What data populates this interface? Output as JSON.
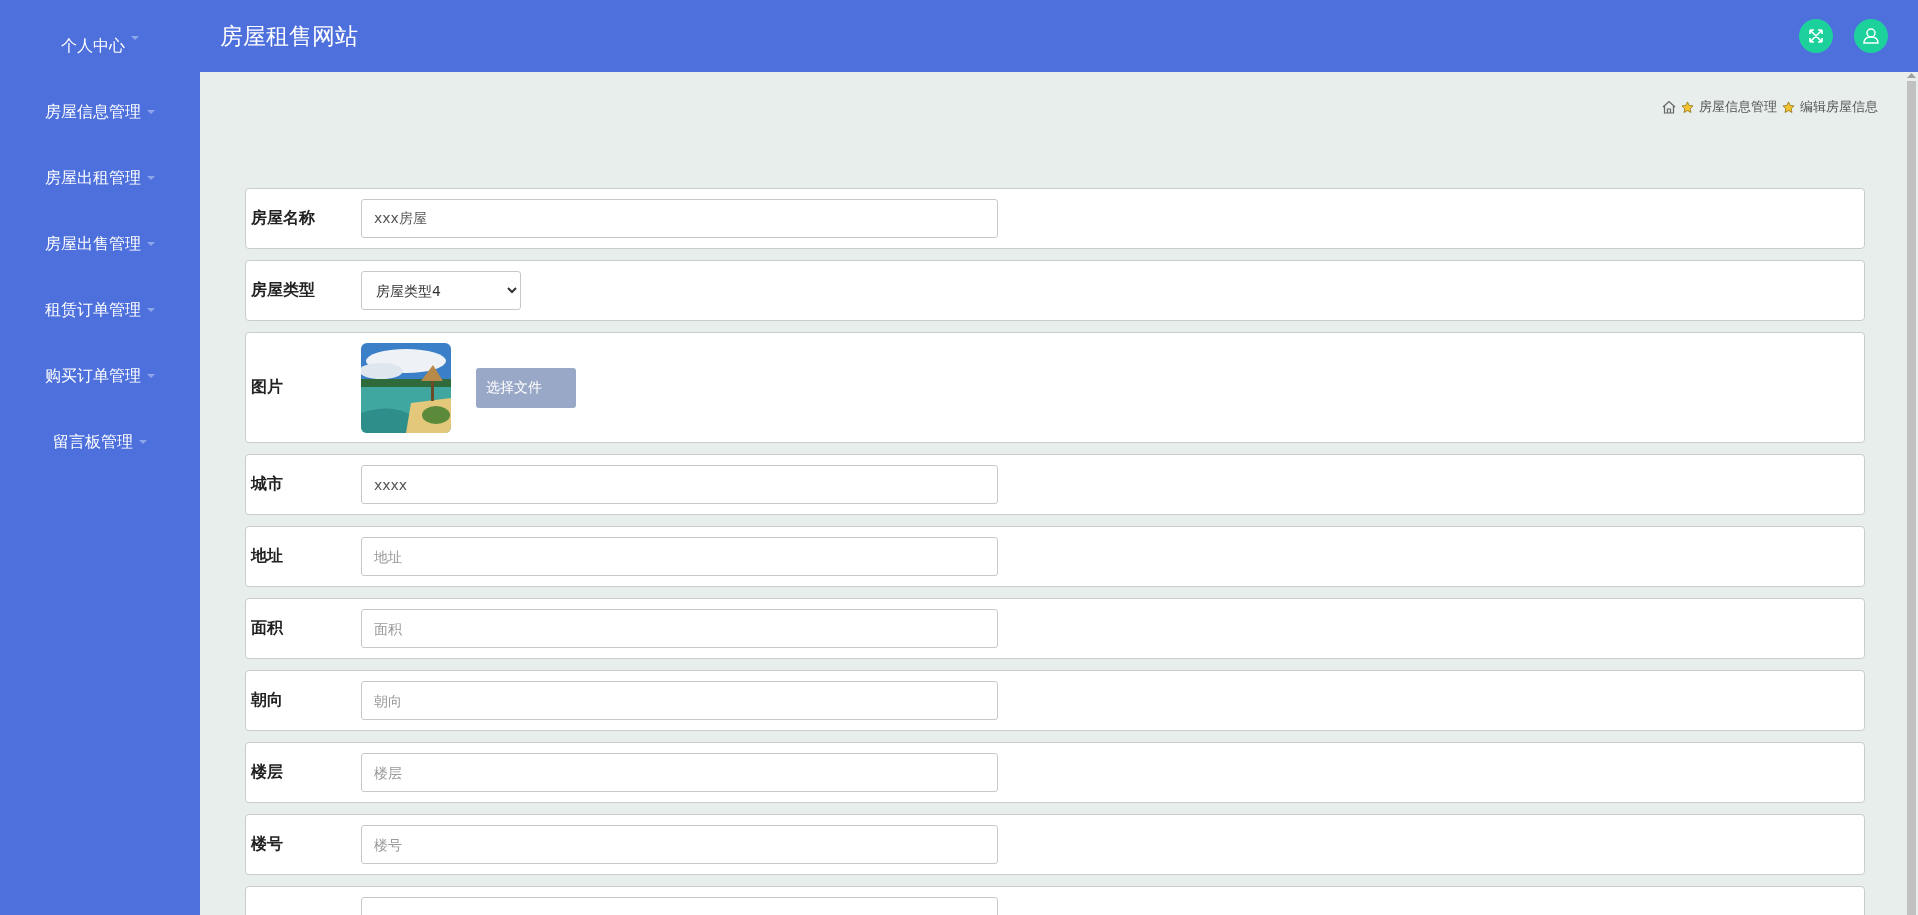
{
  "sidebar": {
    "items": [
      {
        "label": "个人中心",
        "expanded": false
      },
      {
        "label": "房屋信息管理",
        "expanded": false
      },
      {
        "label": "房屋出租管理",
        "expanded": false
      },
      {
        "label": "房屋出售管理",
        "expanded": false
      },
      {
        "label": "租赁订单管理",
        "expanded": false
      },
      {
        "label": "购买订单管理",
        "expanded": false
      },
      {
        "label": "留言板管理",
        "expanded": false
      }
    ]
  },
  "header": {
    "title": "房屋租售网站"
  },
  "breadcrumb": [
    "房屋信息管理",
    "编辑房屋信息"
  ],
  "form": {
    "fields": [
      {
        "kind": "text",
        "label": "房屋名称",
        "value": "xxx房屋"
      },
      {
        "kind": "select",
        "label": "房屋类型",
        "value": "房屋类型4"
      },
      {
        "label": "图片",
        "button": "选择文件"
      },
      {
        "kind": "text",
        "label": "城市",
        "value": "xxxx"
      },
      {
        "kind": "text",
        "label": "地址",
        "placeholder": "地址"
      },
      {
        "kind": "text",
        "label": "面积",
        "placeholder": "面积"
      },
      {
        "kind": "text",
        "label": "朝向",
        "placeholder": "朝向"
      },
      {
        "kind": "text",
        "label": "楼层",
        "placeholder": "楼层"
      },
      {
        "kind": "text",
        "label": "楼号",
        "placeholder": "楼号"
      },
      {
        "kind": "text"
      }
    ]
  }
}
